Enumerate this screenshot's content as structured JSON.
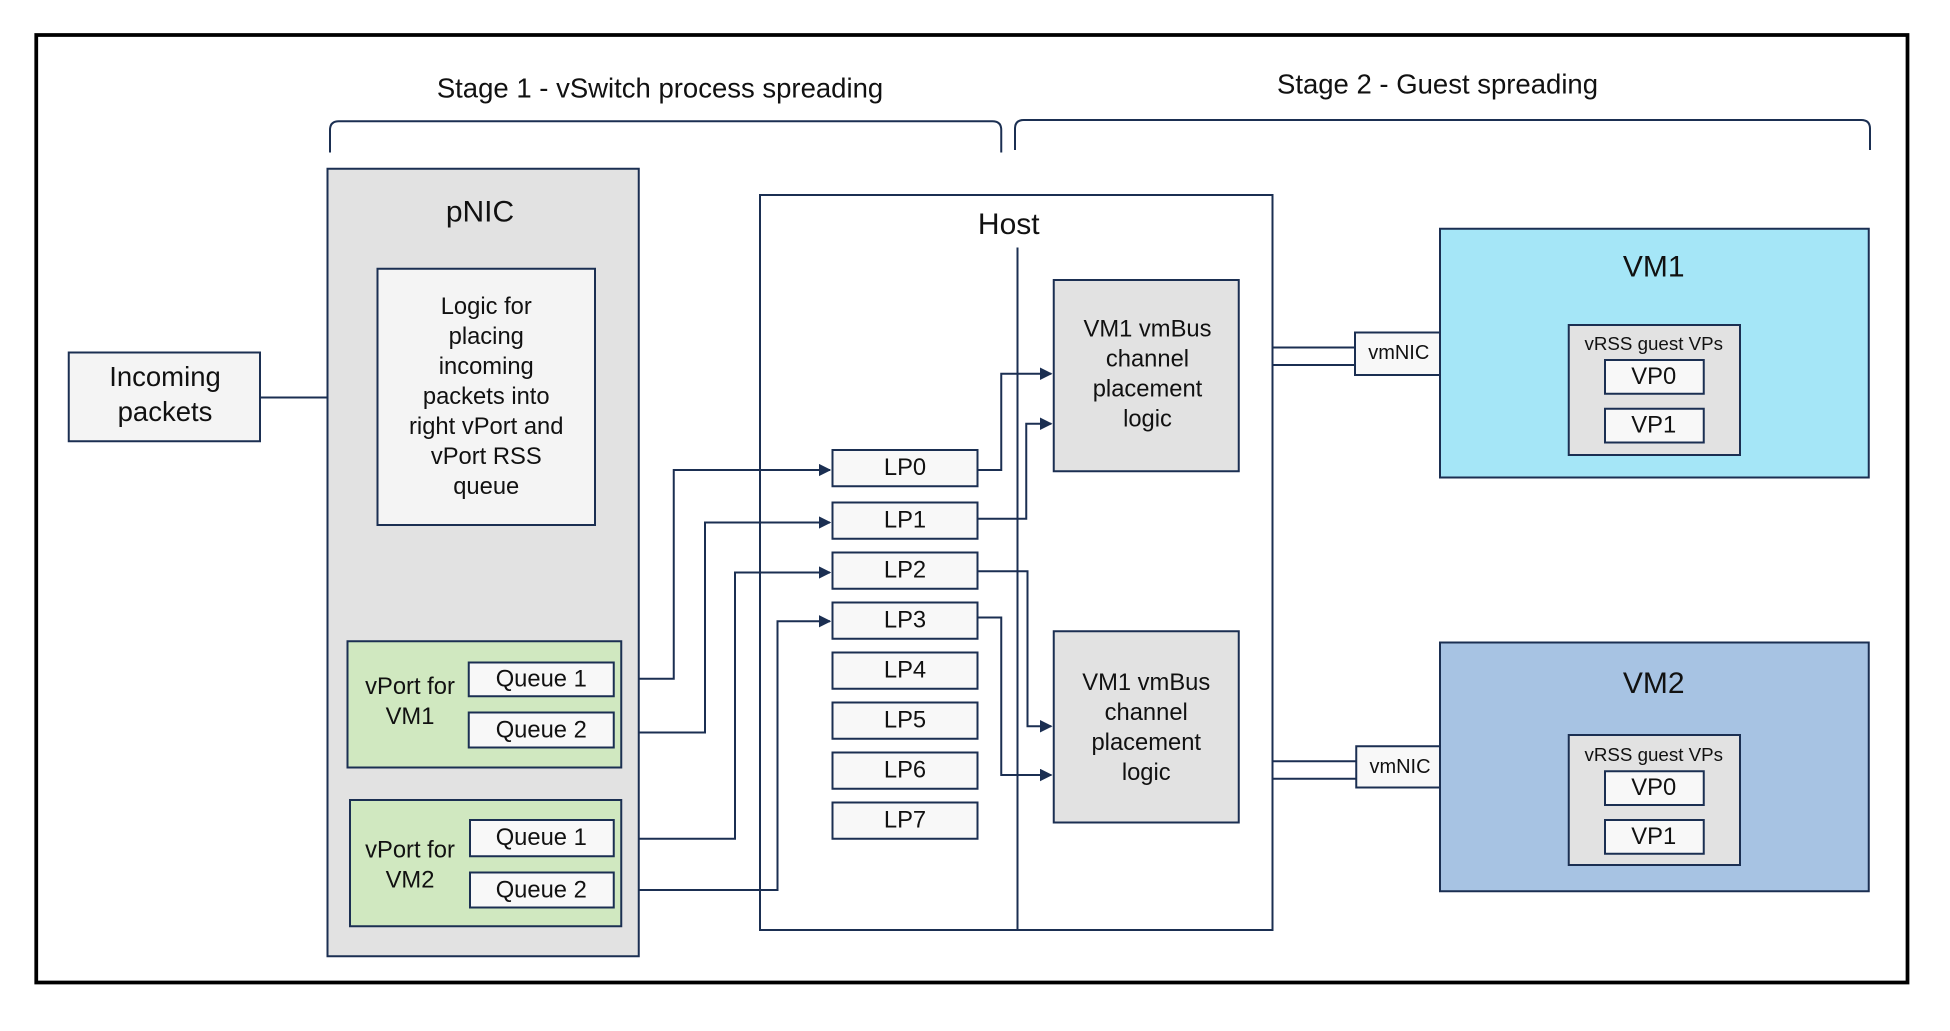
{
  "stage1_label": "Stage 1 - vSwitch process spreading",
  "stage2_label": "Stage 2 - Guest spreading",
  "incoming": [
    "Incoming",
    "packets"
  ],
  "pnic": {
    "title": "pNIC",
    "logic": [
      "Logic for",
      "placing",
      "incoming",
      "packets into",
      "right vPort and",
      "vPort RSS",
      "queue"
    ],
    "vport_vm1": {
      "label": [
        "vPort for",
        "VM1"
      ],
      "queues": [
        "Queue 1",
        "Queue 2"
      ]
    },
    "vport_vm2": {
      "label": [
        "vPort for",
        "VM2"
      ],
      "queues": [
        "Queue 1",
        "Queue 2"
      ]
    }
  },
  "host": {
    "title": "Host",
    "lps": [
      "LP0",
      "LP1",
      "LP2",
      "LP3",
      "LP4",
      "LP5",
      "LP6",
      "LP7"
    ],
    "vmbus1": [
      "VM1 vmBus",
      "channel",
      "placement",
      "logic"
    ],
    "vmbus2": [
      "VM1 vmBus",
      "channel",
      "placement",
      "logic"
    ]
  },
  "vm1": {
    "title": "VM1",
    "vmnic": "vmNIC",
    "vrss": "vRSS guest VPs",
    "vps": [
      "VP0",
      "VP1"
    ]
  },
  "vm2": {
    "title": "VM2",
    "vmnic": "vmNIC",
    "vrss": "vRSS guest VPs",
    "vps": [
      "VP0",
      "VP1"
    ]
  },
  "colors": {
    "line": "#1b2f52",
    "pnic_fill": "#e2e2e2",
    "vport_fill": "#d0e8c0",
    "vm1_fill": "#a5e6f7",
    "vm2_fill": "#a7c3e3"
  }
}
